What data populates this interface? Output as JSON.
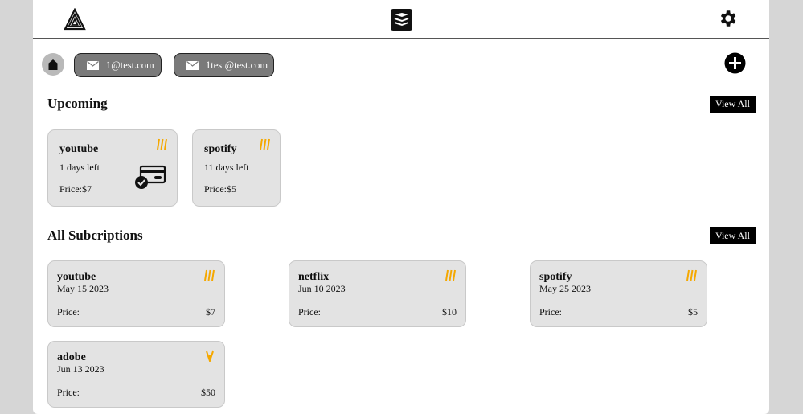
{
  "header": {
    "left_logo_icon": "stacked-triangle-logo-icon",
    "center_logo_icon": "stacked-layers-logo-icon",
    "settings_icon": "gear-icon"
  },
  "toolbar": {
    "home_icon": "home-icon",
    "accounts": [
      {
        "email": "1@test.com",
        "icon": "mail-icon"
      },
      {
        "email": "1test@test.com",
        "icon": "mail-icon"
      }
    ],
    "add_icon": "plus-circle-icon"
  },
  "upcoming": {
    "title": "Upcoming",
    "view_all_label": "View All",
    "cards": [
      {
        "name": "youtube",
        "days_left": "1 days left",
        "price": "Price:$7",
        "icon": "bars-icon",
        "extra_icon": "credit-card-check-icon"
      },
      {
        "name": "spotify",
        "days_left": "11 days left",
        "price": "Price:$5",
        "icon": "bars-icon"
      }
    ]
  },
  "all_subscriptions": {
    "title": "All Subcriptions",
    "view_all_label": "View All",
    "cards": [
      {
        "name": "youtube",
        "date": "May 15 2023",
        "price_label": "Price:",
        "price": "$7",
        "icon": "bars-icon"
      },
      {
        "name": "netflix",
        "date": "Jun 10 2023",
        "price_label": "Price:",
        "price": "$10",
        "icon": "bars-icon"
      },
      {
        "name": "spotify",
        "date": "May 25 2023",
        "price_label": "Price:",
        "price": "$5",
        "icon": "bars-icon"
      },
      {
        "name": "adobe",
        "date": "Jun 13 2023",
        "price_label": "Price:",
        "price": "$50",
        "icon": "v-bars-icon"
      }
    ]
  },
  "colors": {
    "background": "#d6d6d6",
    "card": "#e3e3e3",
    "chip": "#7a7a7a",
    "button": "#000000",
    "accent": "#f5a800"
  }
}
